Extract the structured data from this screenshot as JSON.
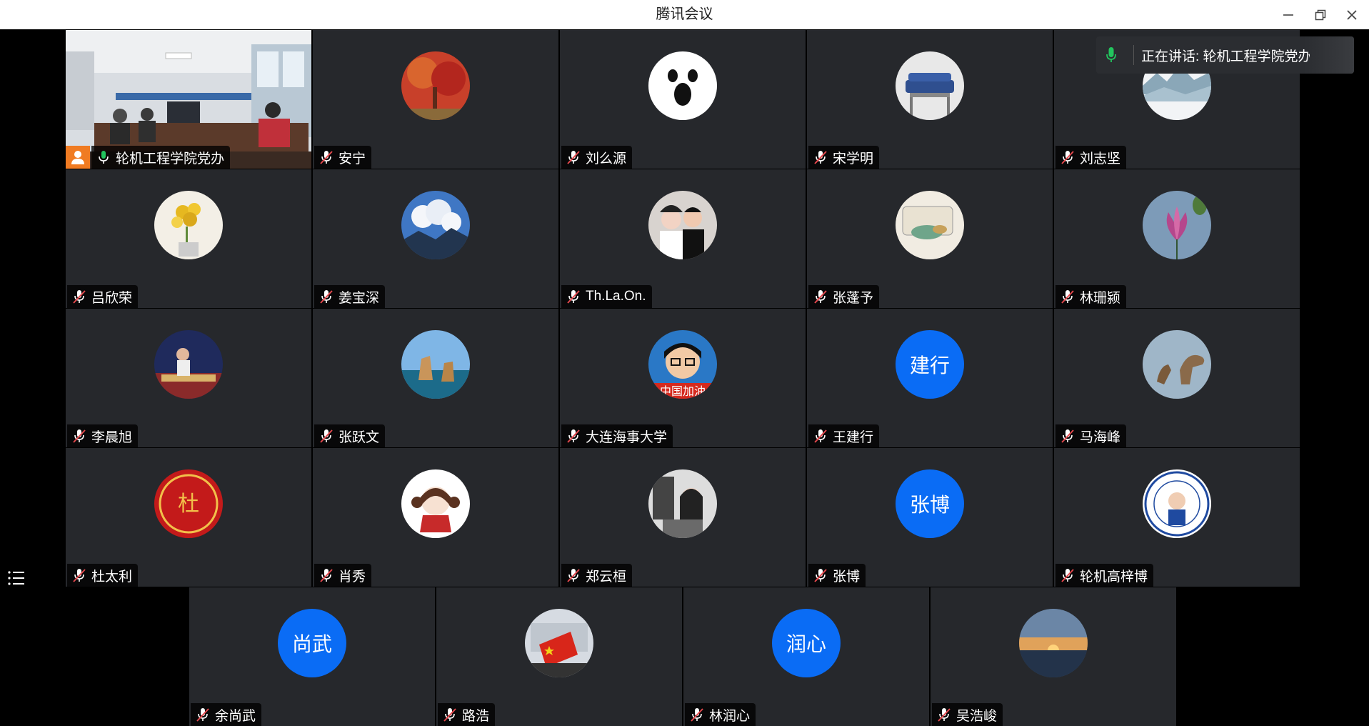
{
  "window": {
    "title": "腾讯会议",
    "minimize_icon": "minimize-icon",
    "restore_icon": "restore-icon",
    "close_icon": "close-icon"
  },
  "speaking_banner": {
    "text": "正在讲话: 轮机工程学院党办;",
    "icon": "mic-active-icon"
  },
  "participant_list_icon": "list-icon",
  "colors": {
    "tile_bg": "#26282c",
    "text_avatar_bg": "#0a6cf5",
    "active_border": "#22b35a",
    "host_badge": "#f07b22"
  },
  "participants": [
    {
      "name": "轮机工程学院党办",
      "video": true,
      "mic": "on",
      "host": true
    },
    {
      "name": "安宁",
      "mic": "muted"
    },
    {
      "name": "刘么源",
      "mic": "muted"
    },
    {
      "name": "宋学明",
      "mic": "muted"
    },
    {
      "name": "刘志坚",
      "mic": "muted"
    },
    {
      "name": "吕欣荣",
      "mic": "muted"
    },
    {
      "name": "姜宝深",
      "mic": "muted"
    },
    {
      "name": "Th.La.On.",
      "mic": "muted"
    },
    {
      "name": "张蓬予",
      "mic": "muted"
    },
    {
      "name": "林珊颍",
      "mic": "muted"
    },
    {
      "name": "李晨旭",
      "mic": "muted"
    },
    {
      "name": "张跃文",
      "mic": "muted"
    },
    {
      "name": "大连海事大学",
      "mic": "muted"
    },
    {
      "name": "王建行",
      "mic": "muted",
      "avatar_text": "建行"
    },
    {
      "name": "马海峰",
      "mic": "muted"
    },
    {
      "name": "杜太利",
      "mic": "muted"
    },
    {
      "name": "肖秀",
      "mic": "muted"
    },
    {
      "name": "郑云桓",
      "mic": "muted"
    },
    {
      "name": "张博",
      "mic": "muted",
      "avatar_text": "张博"
    },
    {
      "name": "轮机高梓博",
      "mic": "muted"
    },
    {
      "name": "余尚武",
      "mic": "muted",
      "avatar_text": "尚武"
    },
    {
      "name": "路浩",
      "mic": "muted"
    },
    {
      "name": "林润心",
      "mic": "muted",
      "avatar_text": "润心"
    },
    {
      "name": "吴浩峻",
      "mic": "muted"
    }
  ]
}
